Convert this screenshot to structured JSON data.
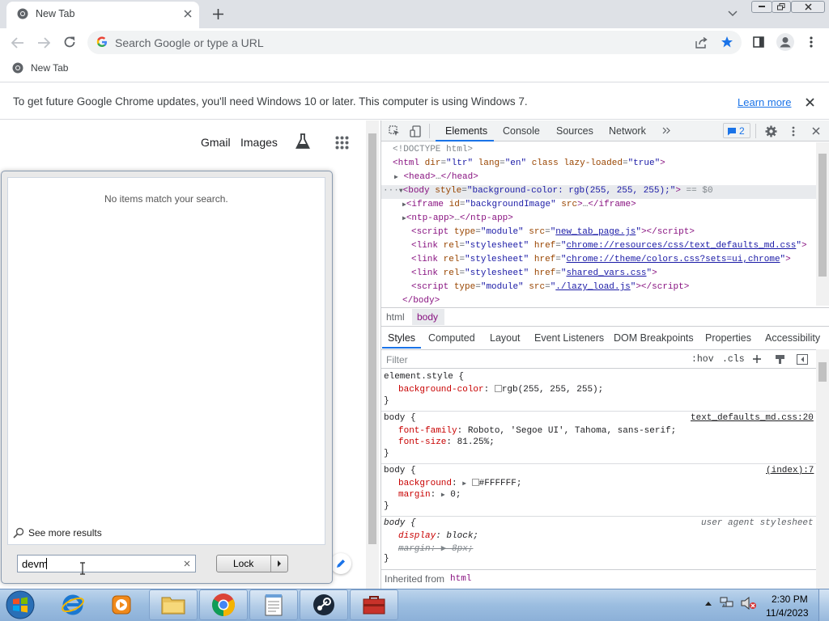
{
  "browser": {
    "tab_title": "New Tab",
    "omnibox_placeholder": "Search Google or type a URL",
    "bookmark": "New Tab",
    "infobar_text": "To get future Google Chrome updates, you'll need Windows 10 or later. This computer is using Windows 7.",
    "infobar_link": "Learn more"
  },
  "ntp": {
    "gmail": "Gmail",
    "images": "Images"
  },
  "search_panel": {
    "empty_message": "No items match your search.",
    "see_more": "See more results",
    "query": "devm",
    "lock_label": "Lock"
  },
  "devtools": {
    "tabs": [
      "Elements",
      "Console",
      "Sources",
      "Network"
    ],
    "issues_count": "2",
    "breadcrumbs": [
      "html",
      "body"
    ],
    "sub_tabs": [
      "Styles",
      "Computed",
      "Layout",
      "Event Listeners",
      "DOM Breakpoints",
      "Properties",
      "Accessibility"
    ],
    "filter_placeholder": "Filter",
    "hov": ":hov",
    "cls": ".cls",
    "inherited_label": "Inherited from",
    "inherited_from": "html",
    "css_sources": {
      "rule2": "text_defaults_md.css:20",
      "rule3": "(index):7",
      "rule4": "user agent stylesheet"
    }
  },
  "taskbar": {
    "time": "2:30 PM",
    "date": "11/4/2023"
  },
  "colors": {
    "accent": "#1a73e8",
    "tag": "#881280",
    "attr_name": "#994500",
    "attr_value": "#1a1aa6",
    "css_prop": "#c80000"
  }
}
